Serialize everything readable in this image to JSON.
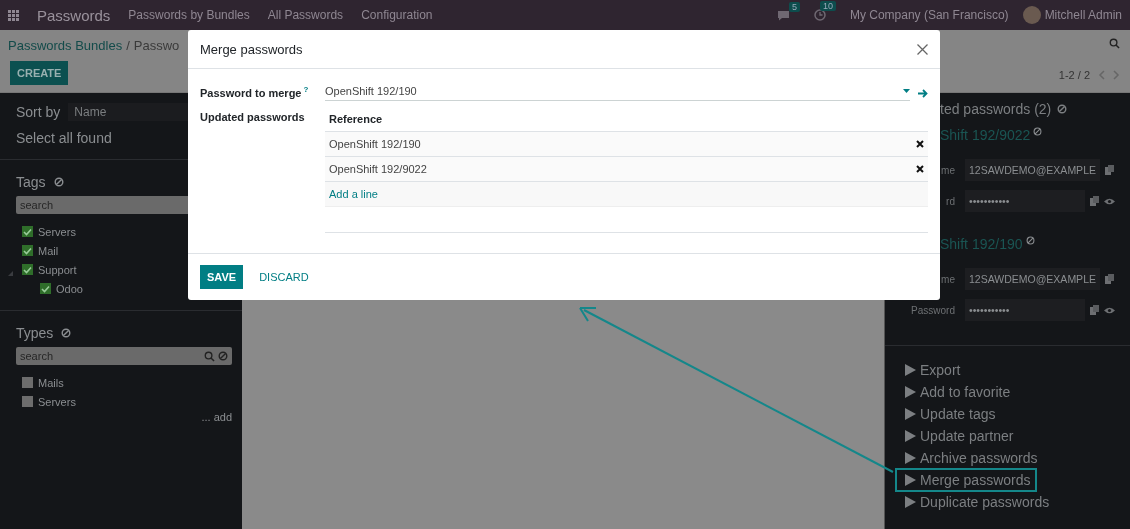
{
  "navbar": {
    "app": "Passwords",
    "menus": [
      "Passwords by Bundles",
      "All Passwords",
      "Configuration"
    ],
    "messages_badge": "5",
    "activities_badge": "10",
    "company": "My Company (San Francisco)",
    "user": "Mitchell Admin"
  },
  "control_panel": {
    "breadcrumb": {
      "parent": "Passwords Bundles",
      "separator": "/",
      "current": "Passwo"
    },
    "create_button": "CREATE",
    "pager": "1-2 / 2"
  },
  "left_panel": {
    "sort_label": "Sort by",
    "sort_value": "Name",
    "select_all": "Select all found",
    "tags": {
      "title": "Tags",
      "search_placeholder": "search",
      "items": [
        {
          "label": "Servers",
          "checked": true
        },
        {
          "label": "Mail",
          "checked": true
        },
        {
          "label": "Support",
          "checked": true,
          "expanded": true,
          "children": [
            {
              "label": "Odoo",
              "checked": true
            }
          ]
        }
      ]
    },
    "types": {
      "title": "Types",
      "search_placeholder": "search",
      "items": [
        {
          "label": "Mails",
          "checked": false
        },
        {
          "label": "Servers",
          "checked": false
        }
      ],
      "add_link": "... add"
    }
  },
  "right_panel": {
    "title": "ted passwords (2)",
    "entries": [
      {
        "name": "Shift 192/9022",
        "fields": [
          {
            "kind": "login",
            "label": "me",
            "value": "12SAWDEMO@EXAMPLE"
          },
          {
            "kind": "secret",
            "label": "rd",
            "value": "•••••••••••"
          }
        ]
      },
      {
        "name": "Shift 192/190",
        "fields": [
          {
            "kind": "login",
            "label": "me",
            "value": "12SAWDEMO@EXAMPLE"
          },
          {
            "kind": "secret",
            "label": "Password",
            "value": "•••••••••••"
          }
        ]
      }
    ],
    "actions": [
      {
        "label": "Export",
        "highlighted": false
      },
      {
        "label": "Add to favorite",
        "highlighted": false
      },
      {
        "label": "Update tags",
        "highlighted": false
      },
      {
        "label": "Update partner",
        "highlighted": false
      },
      {
        "label": "Archive passwords",
        "highlighted": false
      },
      {
        "label": "Merge passwords",
        "highlighted": true
      },
      {
        "label": "Duplicate passwords",
        "highlighted": false
      }
    ]
  },
  "dialog": {
    "title": "Merge passwords",
    "merge_label": "Password to merge",
    "help_mark": "?",
    "merge_value": "OpenShift 192/190",
    "updated_label": "Updated passwords",
    "column": "Reference",
    "rows": [
      "OpenShift 192/190",
      "OpenShift 192/9022"
    ],
    "add_line": "Add a line",
    "save": "SAVE",
    "discard": "DISCARD"
  }
}
